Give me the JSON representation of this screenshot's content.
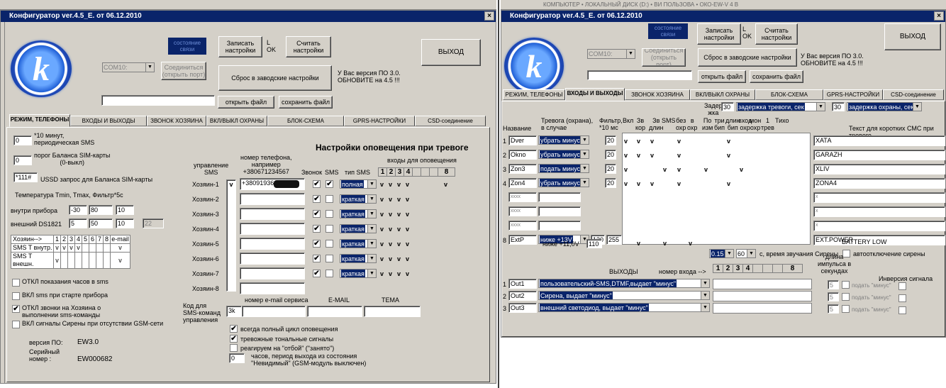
{
  "window_title": "Конфигуратор  ver.4.5_E. от 06.12.2010",
  "top_strip_text": "КОМПЬЮТЕР • ЛОКАЛЬНЫЙ ДИСК (D:) • ВИ ПОЛЬЗОВА • ОКО-EW-V 4 B",
  "common": {
    "status": "состояние\nсвязи",
    "write": "Записать\nнастройки",
    "l_ok": "L\nOK",
    "read": "Считать\nнастройки",
    "exit": "ВЫХОД",
    "com": "COM10:",
    "connect": "Соединиться\n(открыть порт)",
    "reset": "Сброс в заводские настройки",
    "version_note": "У Вас версия ПО 3.0.\nОБНОВИТЕ на 4.5 !!!",
    "open_file": "открыть файл",
    "save_file": "сохранить файл",
    "logo": "k"
  },
  "tabs": [
    "РЕЖИМ, ТЕЛЕФОНЫ",
    "ВХОДЫ И ВЫХОДЫ",
    "ЗВОНОК ХОЗЯИНА",
    "ВКЛ/ВЫКЛ ОХРАНЫ",
    "БЛОК-СХЕМА",
    "GPRS-НАСТРОЙКИ",
    "CSD-соединение"
  ],
  "left": {
    "period_value": "0",
    "period_label": "*10 минут,\nпериодическая SMS",
    "balance_value": "0",
    "balance_label": "порог Баланса SIM-карты\n(0-выкл)",
    "ussd_value": "*111#",
    "ussd_label": "USSD запрос для Баланса SIM-карты",
    "temp_header": "Температура    Tmin,  Tmax, Фильтр*5с",
    "inside_label": "внутри прибора",
    "inside_vals": [
      "-30",
      "80",
      "10"
    ],
    "ext_label": "внешний DS1821",
    "ext_vals": [
      "5",
      "50",
      "10",
      "22"
    ],
    "sms_table": {
      "header": [
        "Хозяин-->",
        "1",
        "2",
        "3",
        "4",
        "5",
        "6",
        "7",
        "8",
        "e-mail"
      ],
      "rows": [
        [
          "SMS T внутр.",
          "v",
          "v",
          "v",
          "v",
          "",
          "",
          "",
          "",
          "v"
        ],
        [
          "SMS T внешн.",
          "v",
          "",
          "",
          "",
          "",
          "",
          "",
          "",
          "v"
        ]
      ]
    },
    "options": [
      {
        "label": "ОТКЛ показания часов в sms",
        "checked": ""
      },
      {
        "label": "ВКЛ sms при старте прибора",
        "checked": ""
      },
      {
        "label": "ОТКЛ звонки на Хозяина о\nвыполнении sms-команды",
        "checked": "✔"
      },
      {
        "label": "ВКЛ сигналы Сирены при отсутствии GSM-сети",
        "checked": ""
      }
    ],
    "fw_label": "версия ПО:",
    "fw_value": "EW3.0",
    "serial_label": "Серийный\nномер :",
    "serial_value": "EW000682"
  },
  "alerts": {
    "title": "Настройки оповещения при тревоге",
    "col_mgmt": "управление\nSMS",
    "col_phone": "номер телефона,\nнапример\n+380671234567",
    "col_call": "Звонок",
    "col_sms": "SMS",
    "col_type": "тип SMS",
    "col_inputs": "входы для оповещения",
    "input_nums": [
      "1",
      "2",
      "3",
      "4",
      "",
      "",
      "",
      "8"
    ],
    "owners": [
      {
        "name": "Хозяин-1",
        "phone": "+38091936",
        "call": "✔",
        "sms": "✔",
        "type": "полная",
        "v": [
          "v",
          "v",
          "v",
          "v",
          "",
          "",
          "",
          "v"
        ]
      },
      {
        "name": "Хозяин-2",
        "phone": "",
        "call": "✔",
        "sms": "",
        "type": "краткая",
        "v": [
          "v",
          "v",
          "v",
          "v",
          "",
          "",
          "",
          ""
        ]
      },
      {
        "name": "Хозяин-3",
        "phone": "",
        "call": "✔",
        "sms": "",
        "type": "краткая",
        "v": [
          "v",
          "v",
          "v",
          "v",
          "",
          "",
          "",
          ""
        ]
      },
      {
        "name": "Хозяин-4",
        "phone": "",
        "call": "✔",
        "sms": "",
        "type": "краткая",
        "v": [
          "v",
          "v",
          "v",
          "v",
          "",
          "",
          "",
          ""
        ]
      },
      {
        "name": "Хозяин-5",
        "phone": "",
        "call": "✔",
        "sms": "",
        "type": "краткая",
        "v": [
          "v",
          "v",
          "v",
          "v",
          "",
          "",
          "",
          ""
        ]
      },
      {
        "name": "Хозяин-6",
        "phone": "",
        "call": "✔",
        "sms": "",
        "type": "краткая",
        "v": [
          "v",
          "v",
          "v",
          "v",
          "",
          "",
          "",
          ""
        ]
      },
      {
        "name": "Хозяин-7",
        "phone": "",
        "call": "✔",
        "sms": "",
        "type": "краткая",
        "v": [
          "v",
          "v",
          "v",
          "v",
          "",
          "",
          "",
          ""
        ]
      },
      {
        "name": "Хозяин-8",
        "phone": "",
        "call": "",
        "sms": "",
        "type": "",
        "v": [
          "",
          "",
          "",
          "",
          "",
          "",
          "",
          ""
        ]
      }
    ],
    "mgmt_mark": "v",
    "email_service": "номер e-mail сервиса",
    "email": "E-MAIL",
    "subject": "ТЕМА",
    "sms_code_label": "Код для\nSMS-команд\nуправления",
    "sms_code": "3k",
    "flags": [
      {
        "label": "всегда полный цикл оповещения",
        "checked": "✔"
      },
      {
        "label": "тревожные тональные сигналы",
        "checked": "✔"
      },
      {
        "label": "реагируем на \"отбой\" (\"занято\")",
        "checked": ""
      }
    ],
    "hours_value": "0",
    "hours_label": "часов, период выхода из состояния\n\"Невидимый\" (GSM-модуль выключен)"
  },
  "io": {
    "delay_label": "Задер\nжка",
    "delay_alarm_val": "30",
    "delay_alarm": "задержка тревоги, сек",
    "delay_guard_val": "30",
    "delay_guard": "задержка охраны, сек",
    "col_name": "Название",
    "col_alarm": "Тревога (охрана),\nв случае",
    "col_filter": "Фильтр,\n*10 мс",
    "col_flags": [
      "Вкл",
      "Зв\nкор",
      "Зв\nдлин",
      "SMS",
      "без\nохр",
      "в\nохр",
      "По\nизм",
      "три\nбип",
      "длин\nбип",
      "вход\nохр",
      "мон\nохр",
      "1\nтрев",
      "Тихо"
    ],
    "col_text": "Текст для коротких СМС при тревоге",
    "inputs": [
      {
        "n": "1",
        "name": "Dver",
        "alarm": "убрать минус",
        "filter": "20",
        "flags": [
          "v",
          "v",
          "v",
          "",
          "v",
          "",
          "",
          "",
          "v",
          "",
          "",
          "",
          ""
        ],
        "text": "ХАТА"
      },
      {
        "n": "2",
        "name": "Okno",
        "alarm": "убрать минус",
        "filter": "20",
        "flags": [
          "v",
          "v",
          "v",
          "",
          "v",
          "",
          "",
          "",
          "v",
          "",
          "",
          "",
          ""
        ],
        "text": "GARAZH"
      },
      {
        "n": "3",
        "name": "Zon3",
        "alarm": "подать минус",
        "filter": "20",
        "flags": [
          "v",
          "",
          "",
          "v",
          "v",
          "",
          "v",
          "",
          "",
          "v",
          "",
          "",
          ""
        ],
        "text": "XLIV"
      },
      {
        "n": "4",
        "name": "Zon4",
        "alarm": "убрать минус",
        "filter": "20",
        "flags": [
          "v",
          "v",
          "v",
          "",
          "v",
          "",
          "",
          "",
          "v",
          "",
          "",
          "",
          ""
        ],
        "text": "ZONA4"
      },
      {
        "n": "",
        "name": "xxxx",
        "alarm": "",
        "filter": "",
        "flags": [
          "",
          "",
          "",
          "",
          "",
          "",
          "",
          "",
          "",
          "",
          "",
          "",
          ""
        ],
        "text": "x"
      },
      {
        "n": "",
        "name": "xxxx",
        "alarm": "",
        "filter": "",
        "flags": [
          "",
          "",
          "",
          "",
          "",
          "",
          "",
          "",
          "",
          "",
          "",
          "",
          ""
        ],
        "text": "x"
      },
      {
        "n": "",
        "name": "xxxx",
        "alarm": "",
        "filter": "",
        "flags": [
          "",
          "",
          "",
          "",
          "",
          "",
          "",
          "",
          "",
          "",
          "",
          "",
          ""
        ],
        "text": "x"
      },
      {
        "n": "8",
        "name": "ExtP",
        "alarm": "ниже +13V",
        "filter": "130",
        "filter2": "255",
        "flags": [
          "",
          "v",
          "",
          "v",
          "",
          "v",
          "",
          "",
          "",
          "",
          "",
          "",
          ""
        ],
        "text": "EXT.POWER"
      }
    ],
    "lower_v_label": "ниже +11,0V",
    "lower_v_val": "110",
    "battery_low": "BATTERY LOW",
    "siren_val1": "0.15",
    "siren_val2": "60",
    "siren_label": "с, время звучания Сирены",
    "siren_auto": "автоотключение сирены",
    "outputs_header": "ВЫХОДЫ",
    "input_num_header": "номер входа -->",
    "out_cols": [
      "1",
      "2",
      "3",
      "4",
      "",
      "",
      "",
      "8"
    ],
    "pulse_label": "длина\nимпульса в\nсекундах",
    "inversion_label": "Инверсия сигнала",
    "outputs": [
      {
        "n": "1",
        "name": "Out1",
        "mode": "пользовательский-SMS,DTMF,выдает \"минус\"",
        "pulse": "5",
        "minus": "подать \"минус\""
      },
      {
        "n": "2",
        "name": "Out2",
        "mode": "Сирена, выдает \"минус\"",
        "pulse": "5",
        "minus": "подать \"минус\""
      },
      {
        "n": "3",
        "name": "Out3",
        "mode": "внешний светодиод, выдает \"минус\"",
        "pulse": "5",
        "minus": "подать \"минус\""
      }
    ]
  }
}
